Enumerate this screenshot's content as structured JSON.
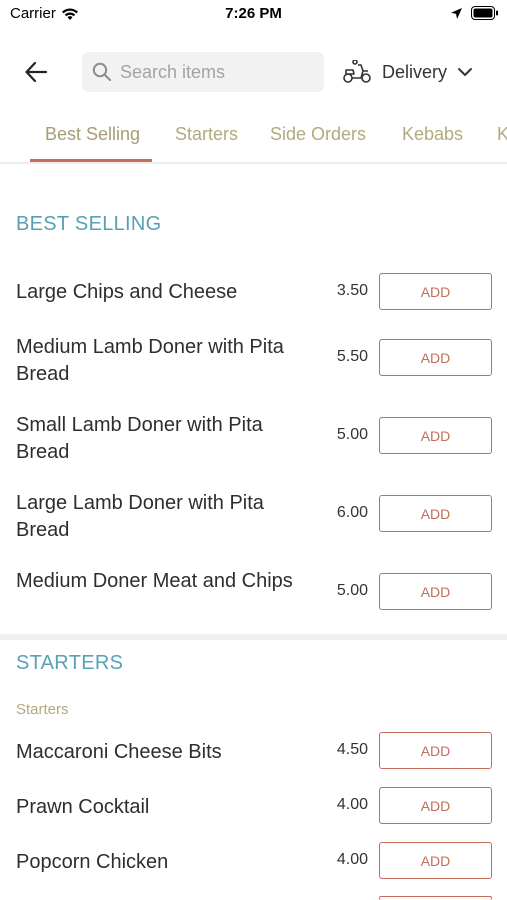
{
  "status_bar": {
    "carrier": "Carrier",
    "time": "7:26 PM"
  },
  "header": {
    "search_placeholder": "Search items",
    "delivery_label": "Delivery"
  },
  "tabs": [
    {
      "label": "Best Selling",
      "active": true
    },
    {
      "label": "Starters"
    },
    {
      "label": "Side Orders"
    },
    {
      "label": "Kebabs"
    },
    {
      "label": "K"
    }
  ],
  "sections": {
    "best_selling": {
      "title": "BEST SELLING",
      "items": [
        {
          "name": "Large Chips and Cheese",
          "price": "3.50",
          "button": "ADD"
        },
        {
          "name": "Medium Lamb Doner with Pita Bread",
          "price": "5.50",
          "button": "ADD"
        },
        {
          "name": "Small Lamb Doner with Pita Bread",
          "price": "5.00",
          "button": "ADD"
        },
        {
          "name": "Large Lamb Doner with Pita Bread",
          "price": "6.00",
          "button": "ADD"
        },
        {
          "name": "Medium Doner Meat and Chips",
          "price": "5.00",
          "button": "ADD"
        }
      ]
    },
    "starters": {
      "title": "STARTERS",
      "subtitle": "Starters",
      "items": [
        {
          "name": "Maccaroni Cheese Bits",
          "price": "4.50",
          "button": "ADD"
        },
        {
          "name": "Prawn Cocktail",
          "price": "4.00",
          "button": "ADD"
        },
        {
          "name": "Popcorn Chicken",
          "price": "4.00",
          "button": "ADD"
        }
      ]
    }
  },
  "colors": {
    "accent": "#c36d5b",
    "section_title": "#5aa0b5",
    "tab_text": "#b3a97f"
  }
}
